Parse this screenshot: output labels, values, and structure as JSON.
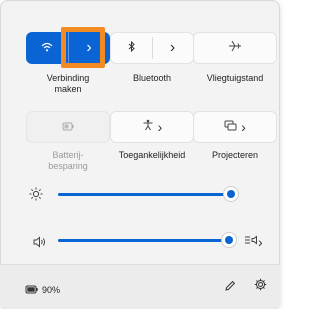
{
  "tiles": {
    "wifi": {
      "label_line1": "Verbinding",
      "label_line2": "maken",
      "chevron": "›"
    },
    "bluetooth": {
      "label": "Bluetooth",
      "chevron": "›"
    },
    "airplane": {
      "label": "Vliegtuigstand"
    },
    "battery_saver": {
      "label_line1": "Batterij-",
      "label_line2": "besparing"
    },
    "accessibility": {
      "label": "Toegankelijkheid",
      "chevron": "›"
    },
    "project": {
      "label": "Projecteren",
      "chevron": "›"
    }
  },
  "sliders": {
    "brightness": {
      "level": 1.0
    },
    "volume": {
      "level": 1.0
    }
  },
  "footer": {
    "battery_percent": "90%"
  },
  "icons": {
    "wifi": "wifi-icon",
    "bluetooth": "bluetooth-icon",
    "airplane": "airplane-icon",
    "battery_saver": "battery-saver-icon",
    "accessibility": "accessibility-icon",
    "project": "project-icon",
    "brightness": "sun-icon",
    "volume": "speaker-icon",
    "audio_output": "audio-output-icon",
    "battery": "battery-icon",
    "edit": "pencil-icon",
    "settings": "gear-icon"
  },
  "colors": {
    "accent": "#0a64d4",
    "highlight": "#f28b22"
  }
}
